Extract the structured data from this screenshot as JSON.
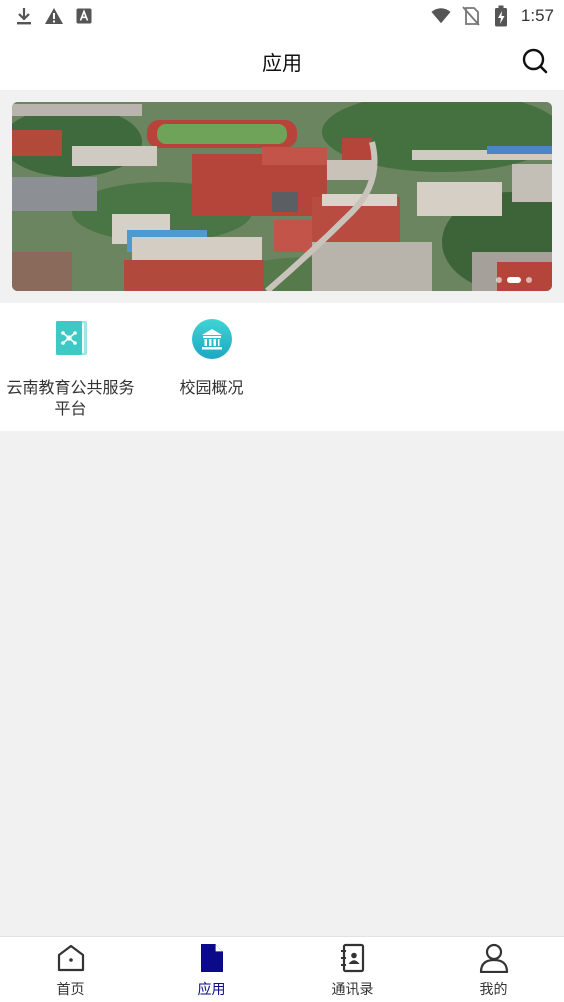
{
  "status_bar": {
    "time": "1:57",
    "left_icons": [
      "download-icon",
      "warning-icon",
      "font-icon"
    ],
    "right_icons": [
      "wifi-icon",
      "no-sim-icon",
      "battery-charging-icon"
    ]
  },
  "header": {
    "title": "应用",
    "search_icon": "search-icon"
  },
  "banner": {
    "image": "aerial-campus-photo",
    "slide_count": 3,
    "active_slide": 2
  },
  "apps": [
    {
      "label": "云南教育公共服务平台",
      "icon": "education-platform-icon",
      "color": "#3ec9c4"
    },
    {
      "label": "校园概况",
      "icon": "campus-building-icon",
      "color": "#27b9c9"
    }
  ],
  "bottom_nav": {
    "active_color": "#0a0a8a",
    "items": [
      {
        "label": "首页",
        "icon": "home-icon"
      },
      {
        "label": "应用",
        "icon": "document-icon",
        "active": true
      },
      {
        "label": "通讯录",
        "icon": "contacts-book-icon"
      },
      {
        "label": "我的",
        "icon": "user-icon"
      }
    ]
  }
}
